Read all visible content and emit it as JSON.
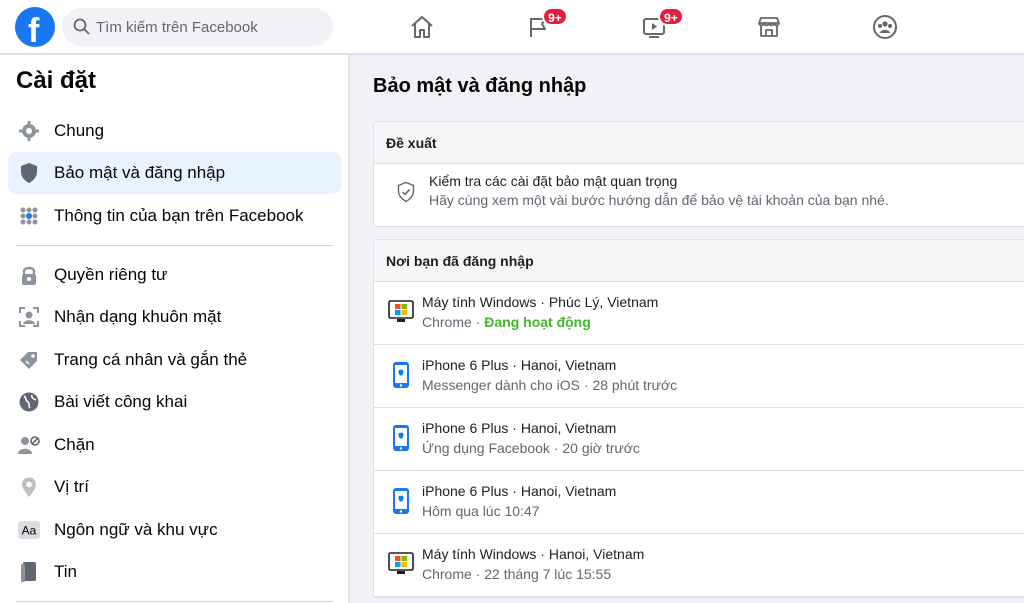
{
  "header": {
    "search_placeholder": "Tìm kiếm trên Facebook",
    "logo_letter": "f",
    "badges": {
      "pages": "9+",
      "watch": "9+"
    }
  },
  "sidebar": {
    "title": "Cài đặt",
    "items": [
      {
        "label": "Chung",
        "icon": "gear-icon"
      },
      {
        "label": "Bảo mật và đăng nhập",
        "icon": "shield-icon",
        "active": true
      },
      {
        "label": "Thông tin của bạn trên Facebook",
        "icon": "grid-icon"
      },
      {
        "label": "Quyền riêng tư",
        "icon": "lock-icon"
      },
      {
        "label": "Nhận dạng khuôn mặt",
        "icon": "face-scan-icon"
      },
      {
        "label": "Trang cá nhân và gắn thẻ",
        "icon": "tag-icon"
      },
      {
        "label": "Bài viết công khai",
        "icon": "globe-icon"
      },
      {
        "label": "Chặn",
        "icon": "block-user-icon"
      },
      {
        "label": "Vị trí",
        "icon": "location-pin-icon"
      },
      {
        "label": "Ngôn ngữ và khu vực",
        "icon": "language-icon"
      },
      {
        "label": "Tin",
        "icon": "book-icon"
      }
    ]
  },
  "main": {
    "title": "Bảo mật và đăng nhập",
    "recommended": {
      "header": "Đề xuất",
      "title": "Kiểm tra các cài đặt bảo mật quan trọng",
      "subtitle": "Hãy cùng xem một vài bước hướng dẫn để bảo vệ tài khoản của bạn nhé."
    },
    "sessions": {
      "header": "Nơi bạn đã đăng nhập",
      "items": [
        {
          "device": "Máy tính Windows",
          "location": "Phúc Lý, Vietnam",
          "app": "Chrome",
          "time": "Đang hoạt động",
          "type": "windows",
          "active": true
        },
        {
          "device": "iPhone 6 Plus",
          "location": "Hanoi, Vietnam",
          "app": "Messenger dành cho iOS",
          "time": "28 phút trước",
          "type": "iphone"
        },
        {
          "device": "iPhone 6 Plus",
          "location": "Hanoi, Vietnam",
          "app": "Ứng dụng Facebook",
          "time": "20 giờ trước",
          "type": "iphone"
        },
        {
          "device": "iPhone 6 Plus",
          "location": "Hanoi, Vietnam",
          "app": "",
          "time": "Hôm qua lúc 10:47",
          "type": "iphone"
        },
        {
          "device": "Máy tính Windows",
          "location": "Hanoi, Vietnam",
          "app": "Chrome",
          "time": "22 tháng 7 lúc 15:55",
          "type": "windows"
        }
      ]
    }
  }
}
